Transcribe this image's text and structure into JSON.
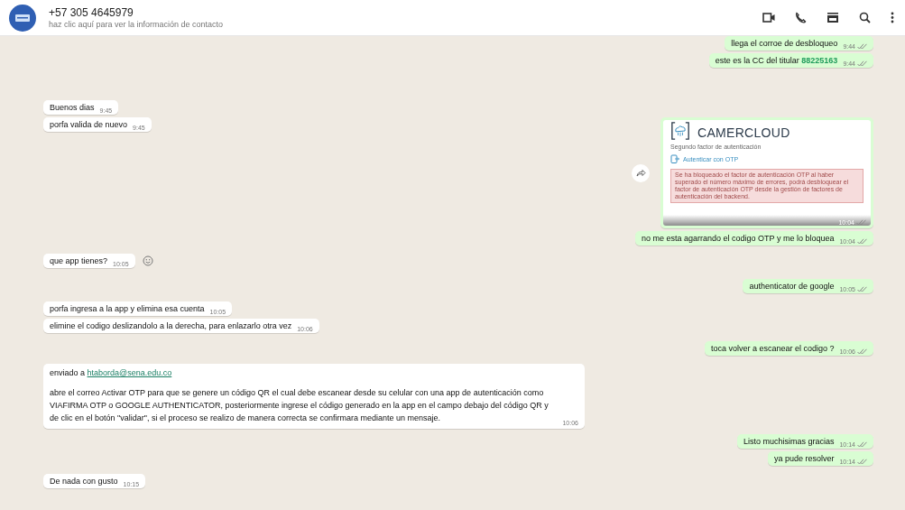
{
  "header": {
    "contact_name": "+57 305 4645979",
    "subtitle": "haz clic aquí para ver la información de contacto"
  },
  "messages": [
    {
      "kind": "text",
      "outgoing": true,
      "text": "llega el corroe de desbloqueo",
      "time": "9:44",
      "delivered": true
    },
    {
      "kind": "text",
      "outgoing": true,
      "text": "este es la CC del titular **88225163**",
      "time": "9:44",
      "delivered": true
    },
    {
      "kind": "text",
      "outgoing": false,
      "text": "Buenos dias",
      "time": "9:45"
    },
    {
      "kind": "text",
      "outgoing": false,
      "text": "porfa valida de nuevo",
      "time": "9:45"
    },
    {
      "kind": "image",
      "outgoing": true,
      "forward_button": true,
      "screenshot": {
        "brand": "CAMERCLOUD",
        "subtitle": "Segundo factor de autenticación",
        "option": "Autenticar con OTP",
        "alert": "Se ha bloqueado el factor de autenticación OTP al haber superado el número máximo de errores, podrá desbloquear el factor de autenticación OTP desde la gestión de factores de autenticación del backend."
      },
      "time": "10:04",
      "delivered": true
    },
    {
      "kind": "text",
      "outgoing": true,
      "text": "no me esta agarrando el codigo OTP y me lo bloquea",
      "time": "10:04",
      "delivered": true
    },
    {
      "kind": "text",
      "outgoing": false,
      "text": "que app tienes?",
      "time": "10:05",
      "emoji_button": true
    },
    {
      "kind": "text",
      "outgoing": true,
      "text": "authenticator de google",
      "time": "10:05",
      "delivered": true
    },
    {
      "kind": "text",
      "outgoing": false,
      "text": "porfa ingresa a la app y elimina esa cuenta",
      "time": "10:05"
    },
    {
      "kind": "text",
      "outgoing": false,
      "text": "elimine el codigo deslizandolo a la derecha, para enlazarlo otra vez",
      "time": "10:06"
    },
    {
      "kind": "text",
      "outgoing": true,
      "text": "toca volver a escanear el codigo ?",
      "time": "10:06",
      "delivered": true
    },
    {
      "kind": "email",
      "outgoing": false,
      "intro": "enviado a ",
      "email": "htaborda@sena.edu.co",
      "body": "abre el correo Activar OTP para que se genere un código QR el cual debe escanear desde su celular con una app de autenticación como VIAFIRMA OTP o GOOGLE AUTHENTICATOR, posteriormente ingrese el código generado en la app en el campo debajo del código QR y de clic en el botón \"validar\", si el proceso se realizo de manera correcta se confirmara mediante un mensaje.",
      "time": "10:06"
    },
    {
      "kind": "text",
      "outgoing": true,
      "text": "Listo muchisimas gracias",
      "time": "10:14",
      "delivered": true
    },
    {
      "kind": "text",
      "outgoing": true,
      "text": "ya pude resolver",
      "time": "10:14",
      "delivered": true
    },
    {
      "kind": "text",
      "outgoing": false,
      "text": "De nada con gusto",
      "time": "10:15"
    }
  ]
}
